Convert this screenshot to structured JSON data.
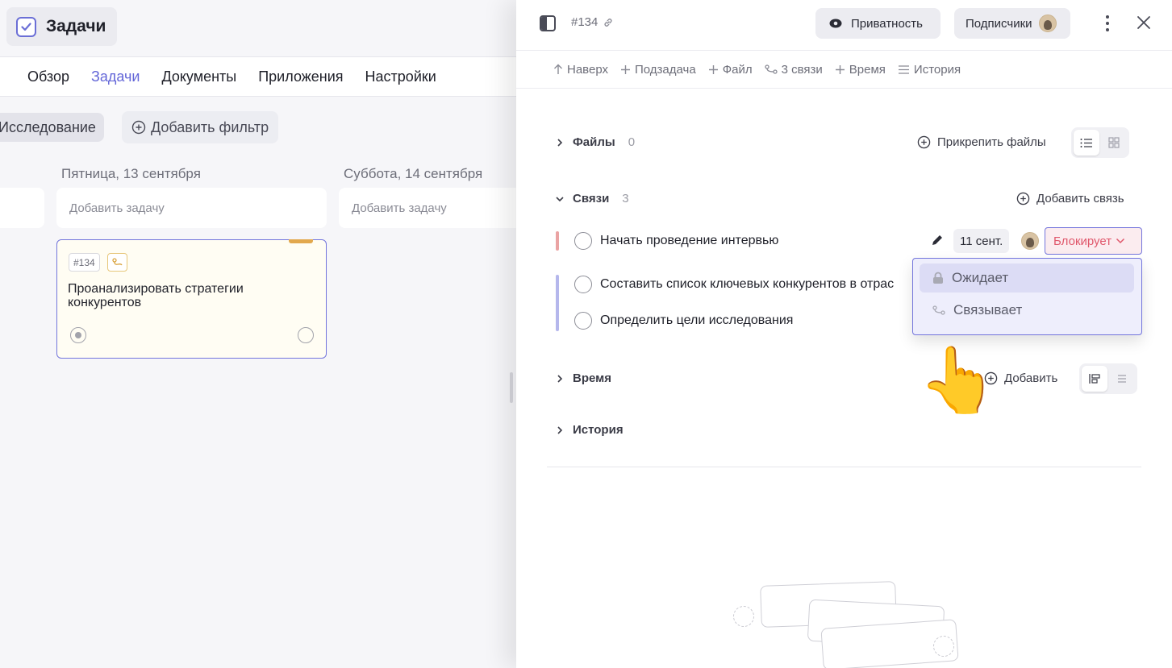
{
  "app": {
    "title": "Задачи"
  },
  "nav": {
    "tabs": [
      "Обзор",
      "Задачи",
      "Документы",
      "Приложения",
      "Настройки"
    ],
    "active": "Задачи"
  },
  "filters": {
    "active_chip": "Исследование",
    "add_filter": "Добавить фильтр"
  },
  "columns": [
    {
      "date": "Пятница, 13 сентября",
      "add_task": "Добавить задачу"
    },
    {
      "date": "Суббота, 14 сентября",
      "add_task": "Добавить задачу"
    }
  ],
  "card": {
    "id": "#134",
    "title": "Проанализировать стратегии конкурентов",
    "accent_color": "#e2a84d"
  },
  "panel": {
    "task_id": "#134",
    "privacy": "Приватность",
    "subscribers": "Подписчики",
    "toolbar": {
      "up": "Наверх",
      "subtask": "Подзадача",
      "file": "Файл",
      "links": "3 связи",
      "time": "Время",
      "history": "История"
    },
    "files": {
      "label": "Файлы",
      "count": "0",
      "action": "Прикрепить файлы"
    },
    "links": {
      "label": "Связи",
      "count": "3",
      "action": "Добавить связь",
      "items": [
        {
          "title": "Начать проведение интервью",
          "date": "11 сент.",
          "relation": "Блокирует"
        },
        {
          "title": "Составить список ключевых конкурентов в отрас"
        },
        {
          "title": "Определить цели исследования"
        }
      ],
      "dropdown": [
        {
          "label": "Ожидает",
          "icon": "lock-icon"
        },
        {
          "label": "Связывает",
          "icon": "link-icon"
        }
      ]
    },
    "time": {
      "label": "Время",
      "action": "Добавить"
    },
    "history": {
      "label": "История"
    }
  },
  "colors": {
    "accent": "#6366d8",
    "danger": "#e0576b",
    "highlight": "#eeeefc"
  }
}
